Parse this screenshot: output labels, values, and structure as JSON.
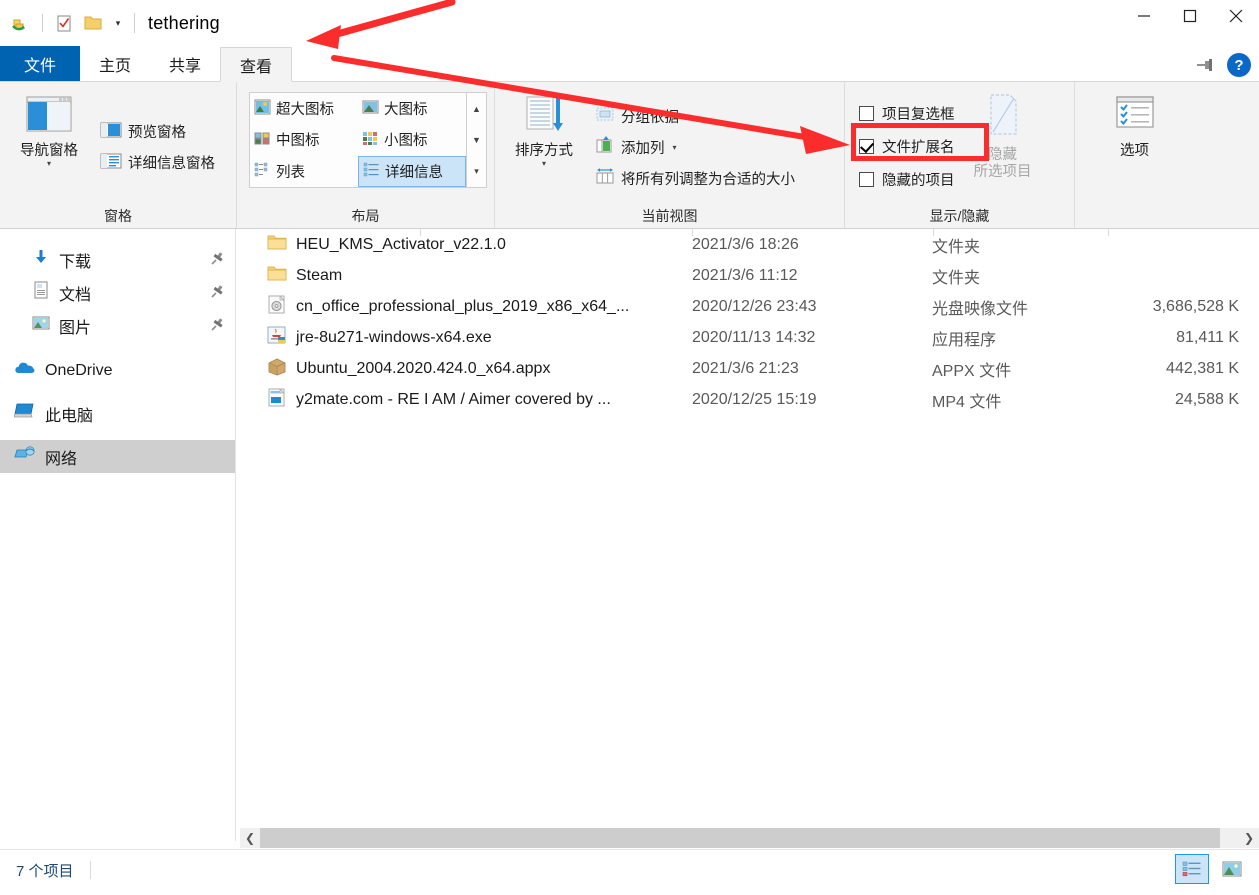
{
  "window": {
    "title": "tethering",
    "quick_access": [
      "restore-icon",
      "properties-icon",
      "new-folder-icon"
    ],
    "customize_caret": "▾",
    "controls": {
      "minimize": "—",
      "maximize": "▢",
      "close": "✕"
    }
  },
  "ribbon": {
    "tabs": [
      {
        "label": "文件",
        "id": "file",
        "state": "file"
      },
      {
        "label": "主页",
        "id": "home",
        "state": "normal"
      },
      {
        "label": "共享",
        "id": "share",
        "state": "normal"
      },
      {
        "label": "查看",
        "id": "view",
        "state": "active"
      }
    ],
    "pin_label": "固定功能区",
    "help_label": "?",
    "groups": [
      {
        "id": "panes",
        "label": "窗格",
        "big_button": {
          "label": "导航窗格",
          "caret": "▾"
        },
        "items": [
          {
            "label": "预览窗格",
            "icon": "preview-pane-icon"
          },
          {
            "label": "详细信息窗格",
            "icon": "details-pane-icon"
          }
        ]
      },
      {
        "id": "layout",
        "label": "布局",
        "gallery": [
          {
            "label": "超大图标",
            "selected": false
          },
          {
            "label": "大图标",
            "selected": false
          },
          {
            "label": "中图标",
            "selected": false
          },
          {
            "label": "小图标",
            "selected": false
          },
          {
            "label": "列表",
            "selected": false
          },
          {
            "label": "详细信息",
            "selected": true
          }
        ],
        "scroll": {
          "up": "▲",
          "down": "▼",
          "more": "▾"
        }
      },
      {
        "id": "current-view",
        "label": "当前视图",
        "big_button": {
          "label": "排序方式",
          "caret": "▾"
        },
        "items": [
          {
            "label": "分组依据",
            "icon": "group-by-icon",
            "caret": "▾"
          },
          {
            "label": "添加列",
            "icon": "add-column-icon",
            "caret": "▾"
          },
          {
            "label": "将所有列调整为合适的大小",
            "icon": "size-columns-icon",
            "caret": ""
          }
        ]
      },
      {
        "id": "show-hide",
        "label": "显示/隐藏",
        "checkboxes": [
          {
            "label": "项目复选框",
            "checked": false,
            "highlighted": false
          },
          {
            "label": "文件扩展名",
            "checked": true,
            "highlighted": true
          },
          {
            "label": "隐藏的项目",
            "checked": false,
            "highlighted": false
          }
        ],
        "big_button": {
          "label_line1": "隐藏",
          "label_line2": "所选项目",
          "disabled": true
        }
      },
      {
        "id": "options",
        "label": "",
        "big_button": {
          "label": "选项",
          "caret": ""
        }
      }
    ]
  },
  "navigation": {
    "items": [
      {
        "label": "下载",
        "icon": "download-icon",
        "pinned": true,
        "selected": false,
        "indent": true
      },
      {
        "label": "文档",
        "icon": "documents-icon",
        "pinned": true,
        "selected": false,
        "indent": true
      },
      {
        "label": "图片",
        "icon": "pictures-icon",
        "pinned": true,
        "selected": false,
        "indent": true
      },
      {
        "label": "OneDrive",
        "icon": "onedrive-icon",
        "pinned": false,
        "selected": false,
        "indent": false
      },
      {
        "label": "此电脑",
        "icon": "this-pc-icon",
        "pinned": false,
        "selected": false,
        "indent": false
      },
      {
        "label": "网络",
        "icon": "network-icon",
        "pinned": false,
        "selected": true,
        "indent": false
      }
    ]
  },
  "file_list": {
    "rows": [
      {
        "name": "HEU_KMS_Activator_v22.1.0",
        "date": "2021/3/6 18:26",
        "type": "文件夹",
        "size": "",
        "icon": "folder-icon"
      },
      {
        "name": "Steam",
        "date": "2021/3/6 11:12",
        "type": "文件夹",
        "size": "",
        "icon": "folder-icon"
      },
      {
        "name": "cn_office_professional_plus_2019_x86_x64_...",
        "date": "2020/12/26 23:43",
        "type": "光盘映像文件",
        "size": "3,686,528 K",
        "icon": "disc-image-icon"
      },
      {
        "name": "jre-8u271-windows-x64.exe",
        "date": "2020/11/13 14:32",
        "type": "应用程序",
        "size": "81,411 K",
        "icon": "java-exe-icon"
      },
      {
        "name": "Ubuntu_2004.2020.424.0_x64.appx",
        "date": "2021/3/6 21:23",
        "type": "APPX 文件",
        "size": "442,381 K",
        "icon": "appx-package-icon"
      },
      {
        "name": "y2mate.com - RE I AM / Aimer covered by ...",
        "date": "2020/12/25 15:19",
        "type": "MP4 文件",
        "size": "24,588 K",
        "icon": "video-file-icon"
      }
    ]
  },
  "scrollbar": {
    "left_arrow": "❮",
    "right_arrow": "❯"
  },
  "status_bar": {
    "item_count": "7 个项目",
    "view_buttons": [
      {
        "name": "details-view-button",
        "selected": true
      },
      {
        "name": "large-icons-view-button",
        "selected": false
      }
    ]
  },
  "annotations": {
    "accent_color": "#fb2c2c",
    "arrow_to_view_tab": "查看",
    "arrow_to_extension_checkbox": "文件扩展名",
    "highlight_box_target": "文件扩展名"
  }
}
